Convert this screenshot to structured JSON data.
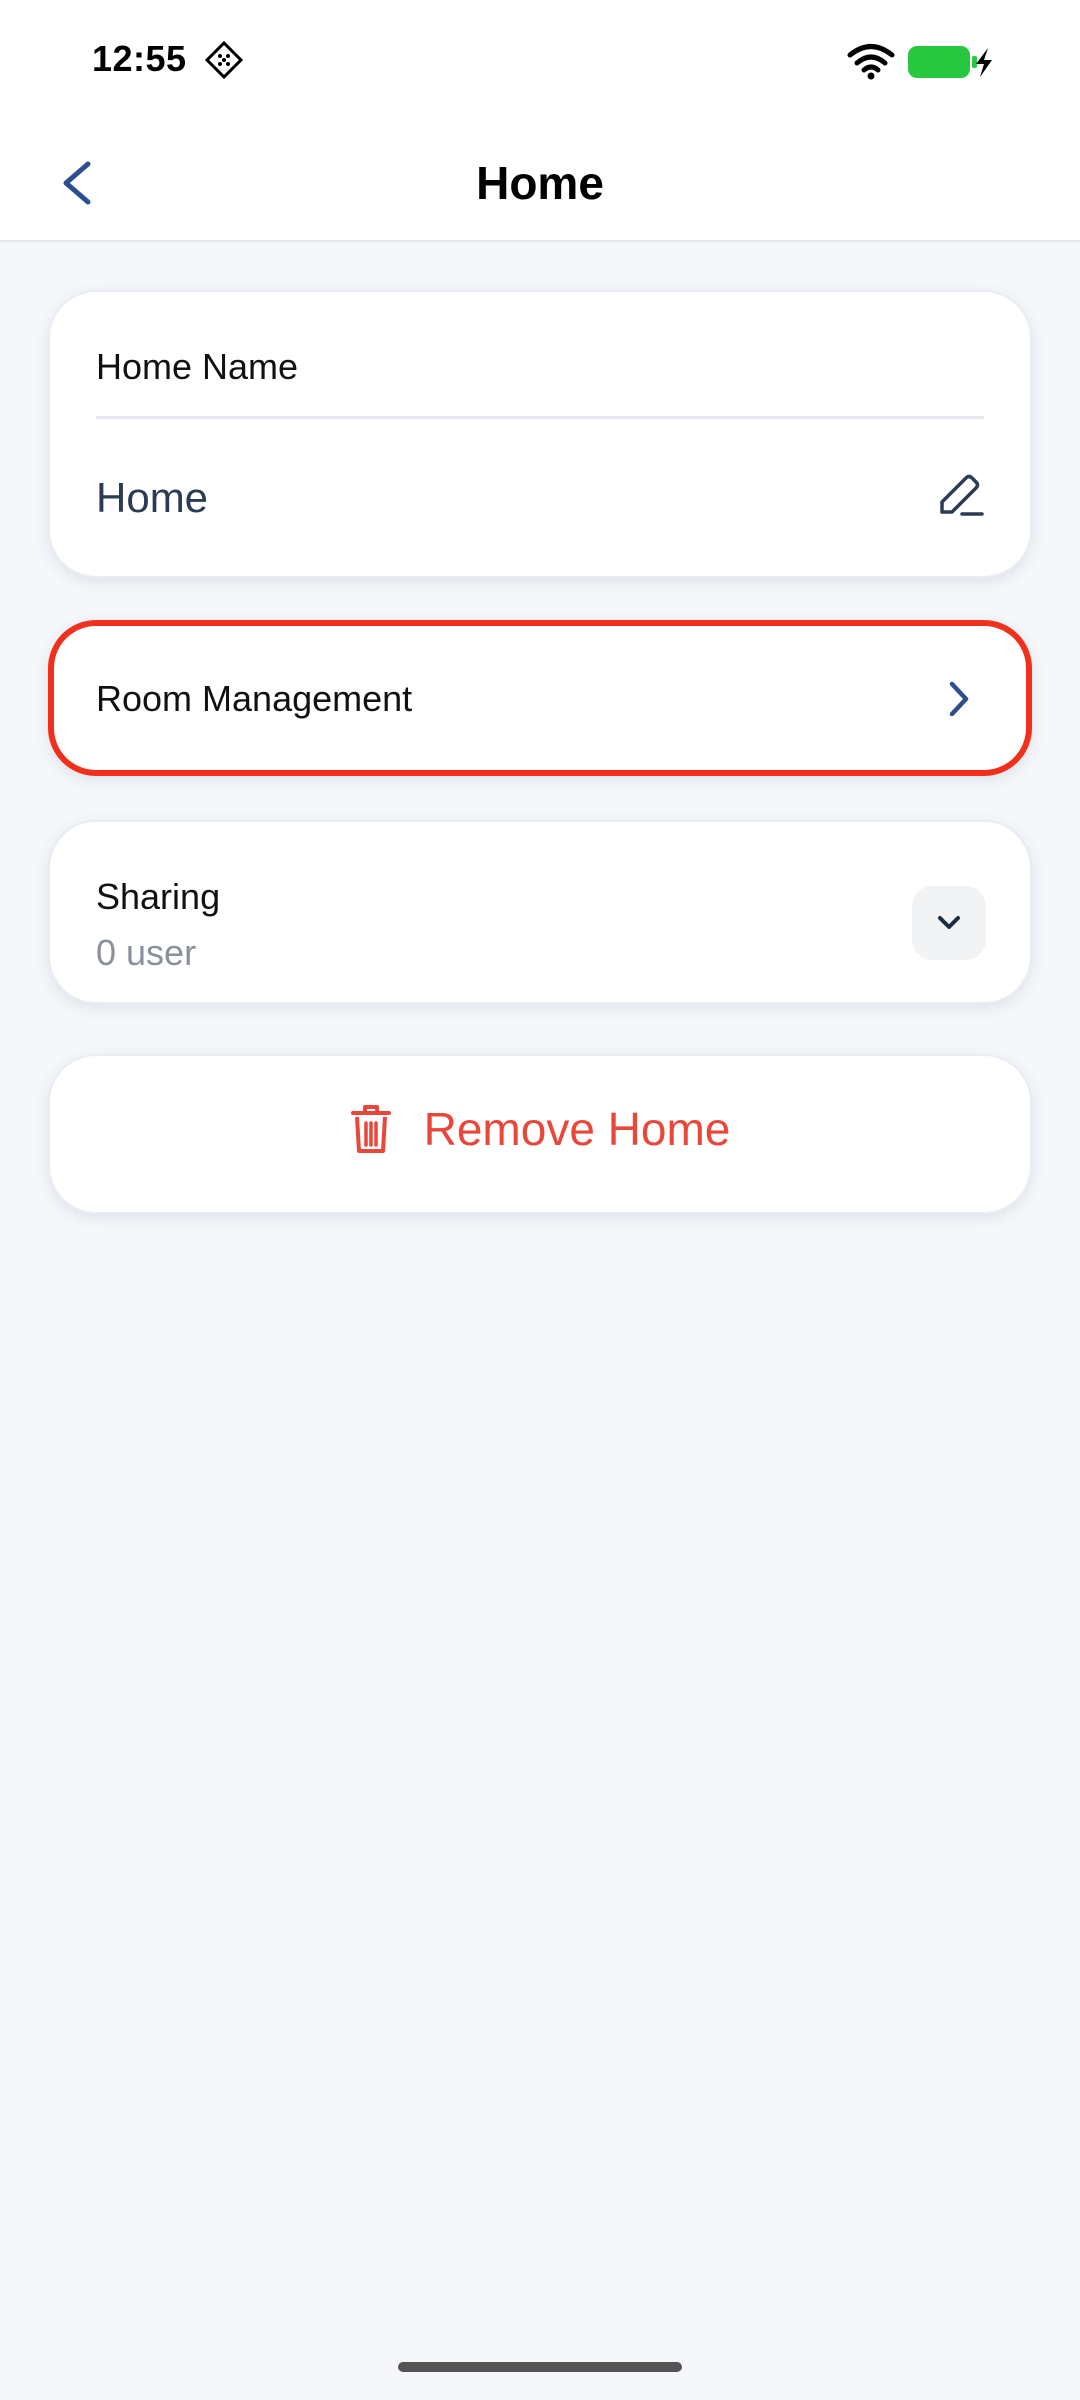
{
  "status_bar": {
    "time": "12:55",
    "battery_color": "#27c840"
  },
  "nav": {
    "title": "Home",
    "back_icon": "chevron-left-icon"
  },
  "home_name_card": {
    "label": "Home Name",
    "value": "Home",
    "edit_icon": "pencil-icon"
  },
  "room_card": {
    "label": "Room Management",
    "highlight_color": "#f0301a"
  },
  "sharing_card": {
    "label": "Sharing",
    "count": "0 user"
  },
  "remove_card": {
    "label": "Remove Home",
    "color": "#e8473a"
  },
  "colors": {
    "accent": "#2b4f8f",
    "background": "#f5f7fa"
  }
}
